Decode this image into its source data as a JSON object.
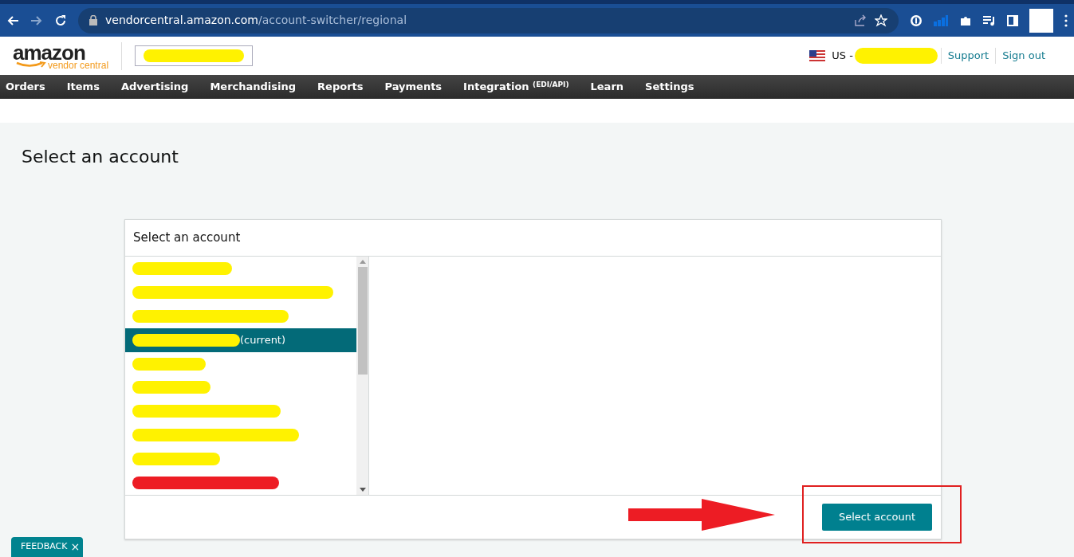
{
  "browser": {
    "url_host": "vendorcentral.amazon.com",
    "url_path": "/account-switcher/regional"
  },
  "header": {
    "logo_word": "amazon",
    "logo_sub": "vendor central",
    "account_box": {
      "color": "#fff200"
    },
    "region": {
      "label": "US -",
      "color": "#fff200"
    },
    "links": [
      "Support",
      "Sign out"
    ]
  },
  "nav": [
    "Orders",
    "Items",
    "Advertising",
    "Merchandising",
    "Reports",
    "Payments",
    "Integration $^{(EDI/API)}$",
    "Learn",
    "Settings"
  ],
  "page_title": "Select an account",
  "panel": {
    "title": "Select an account",
    "accounts": [
      {
        "color": "#fff200",
        "selected": false
      },
      {
        "color": "#fff200",
        "selected": false
      },
      {
        "color": "#fff200",
        "selected": false
      },
      {
        "color": "#fff200",
        "selected": true,
        "suffix": "(current)"
      },
      {
        "color": "#fff200",
        "selected": false
      },
      {
        "color": "#fff200",
        "selected": false
      },
      {
        "color": "#fff200",
        "selected": false
      },
      {
        "color": "#fff200",
        "selected": false
      },
      {
        "color": "#fff200",
        "selected": false
      },
      {
        "color": "#ed1c24",
        "selected": false
      }
    ],
    "button": "Select account"
  },
  "annotations": {
    "arrow": true,
    "highlight_frame": true
  },
  "feedback": {
    "label": "FEEDBACK",
    "close": "×"
  }
}
